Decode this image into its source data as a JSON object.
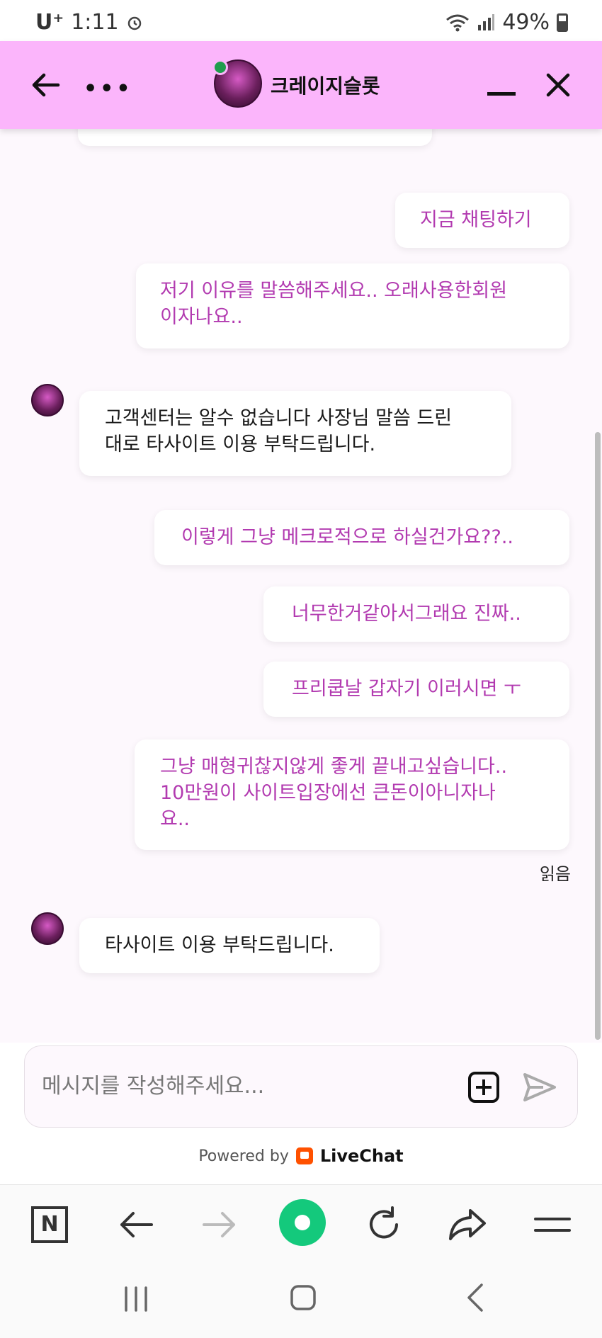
{
  "status_bar": {
    "carrier": "U⁺",
    "time": "1:11",
    "battery": "49%"
  },
  "header": {
    "title": "크레이지슬롯"
  },
  "messages": [
    {
      "direction": "out",
      "lines": [
        "지금 채팅하기"
      ]
    },
    {
      "direction": "out",
      "lines": [
        "저기 이유를 말씀해주세요.. 오래사용한회원",
        "이자나요.."
      ]
    },
    {
      "direction": "in",
      "lines": [
        "고객센터는 알수 없습니다 사장님 말씀 드린",
        "대로 타사이트 이용 부탁드립니다."
      ]
    },
    {
      "direction": "out",
      "lines": [
        "이렇게 그냥 메크로적으로 하실건가요??.."
      ]
    },
    {
      "direction": "out",
      "lines": [
        "너무한거같아서그래요 진짜.."
      ]
    },
    {
      "direction": "out",
      "lines": [
        "프리쿱날 갑자기 이러시면 ㅜ"
      ]
    },
    {
      "direction": "out",
      "lines": [
        "그냥 매형귀찮지않게 좋게 끝내고싶습니다..",
        "10만원이 사이트입장에선 큰돈이아니자나",
        "요.."
      ]
    },
    {
      "direction": "in",
      "lines": [
        "타사이트 이용 부탁드립니다."
      ]
    }
  ],
  "read_receipt": "읽음",
  "composer": {
    "placeholder": "메시지를 작성해주세요..."
  },
  "footer": {
    "powered_by": "Powered by",
    "brand": "LiveChat"
  },
  "browser_toolbar": {
    "naver_label": "N"
  },
  "colors": {
    "header_bg": "#fbb5fb",
    "outgoing_text": "#b23ab0",
    "online_dot": "#1f9d4d",
    "home_button": "#14c97c"
  }
}
